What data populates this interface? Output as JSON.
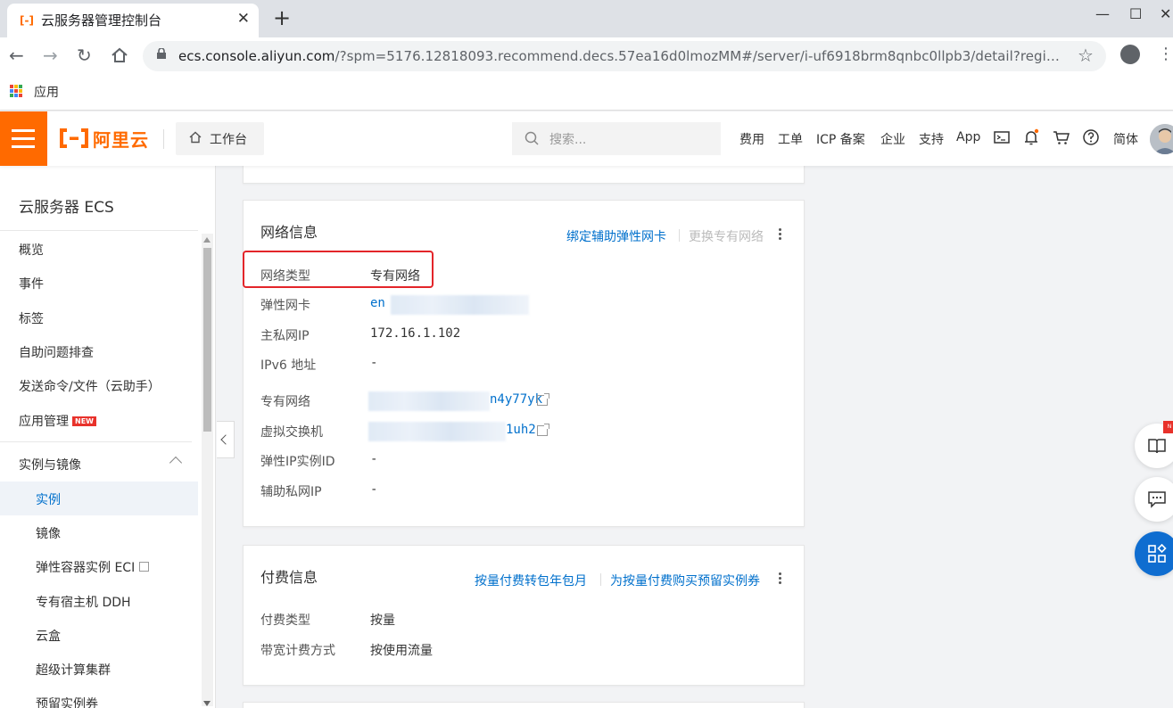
{
  "browser": {
    "tab_title": "云服务器管理控制台",
    "tab_favicon": "[-]",
    "url_host": "ecs.console.aliyun.com",
    "url_rest": "/?spm=5176.12818093.recommend.decs.57ea16d0lmozMM#/server/i-uf6918brm8qnbc0llpb3/detail?regi…",
    "bookmark_apps": "应用",
    "new_tab": "+",
    "close_tab": "✕",
    "minimize": "—",
    "maximize": "☐",
    "close_window": "✕"
  },
  "topbar": {
    "brand": "阿里云",
    "workbench": "工作台",
    "search_placeholder": "搜索...",
    "nav": [
      "费用",
      "工单",
      "ICP 备案",
      "企业",
      "支持",
      "App"
    ],
    "lang": "简体"
  },
  "sidebar": {
    "title": "云服务器 ECS",
    "items": [
      {
        "label": "概览"
      },
      {
        "label": "事件"
      },
      {
        "label": "标签"
      },
      {
        "label": "自助问题排查"
      },
      {
        "label": "发送命令/文件（云助手）"
      },
      {
        "label": "应用管理",
        "badge": "NEW"
      }
    ],
    "group": "实例与镜像",
    "sub_items": [
      {
        "label": "实例",
        "active": true
      },
      {
        "label": "镜像"
      },
      {
        "label": "弹性容器实例 ECI"
      },
      {
        "label": "专有宿主机 DDH"
      },
      {
        "label": "云盒"
      },
      {
        "label": "超级计算集群"
      },
      {
        "label": "预留实例券"
      }
    ]
  },
  "network_card": {
    "title": "网络信息",
    "action_bind": "绑定辅助弹性网卡",
    "action_change": "更换专有网络",
    "rows": [
      {
        "label": "网络类型",
        "value": "专有网络"
      },
      {
        "label": "弹性网卡",
        "value": "en"
      },
      {
        "label": "主私网IP",
        "value": "172.16.1.102"
      },
      {
        "label": "IPv6 地址",
        "value": "-"
      },
      {
        "label": "专有网络",
        "value": "n4y77yk"
      },
      {
        "label": "虚拟交换机",
        "value": "1uh2"
      },
      {
        "label": "弹性IP实例ID",
        "value": "-"
      },
      {
        "label": "辅助私网IP",
        "value": "-"
      }
    ]
  },
  "billing_card": {
    "title": "付费信息",
    "action_convert": "按量付费转包年包月",
    "action_reserve": "为按量付费购买预留实例券",
    "rows": [
      {
        "label": "付费类型",
        "value": "按量"
      },
      {
        "label": "带宽计费方式",
        "value": "按使用流量"
      }
    ]
  },
  "floating": {
    "badge": "N"
  },
  "colors": {
    "brand": "#ff6a00",
    "link": "#0070cc",
    "highlight": "#e3252a",
    "float_blue": "#0f6dd0"
  }
}
